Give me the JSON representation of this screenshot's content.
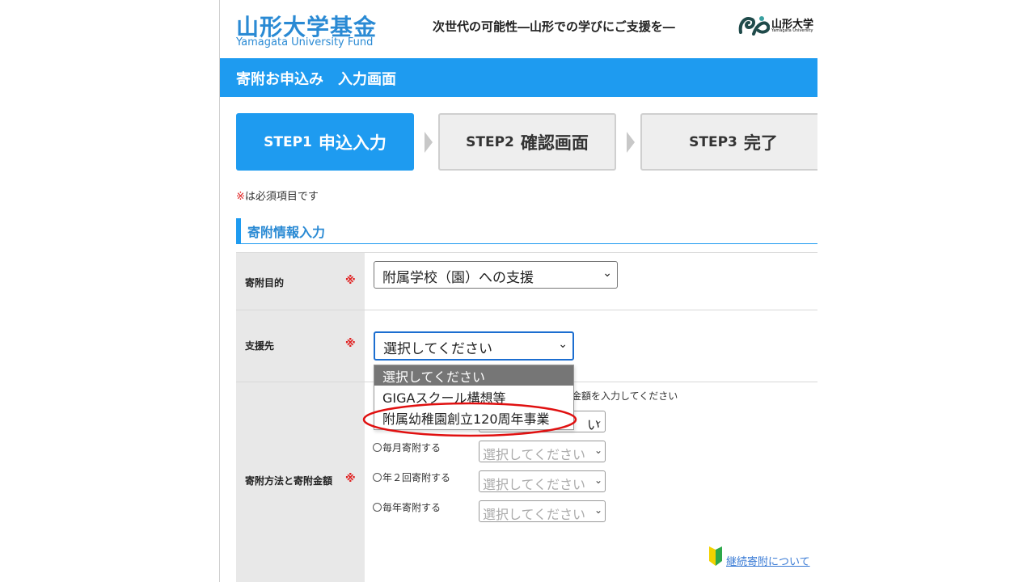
{
  "header": {
    "logo_main": "山形大学基金",
    "logo_sub": "Yamagata University Fund",
    "tagline": "次世代の可能性―山形での学びにご支援を―",
    "university_name": "山形大学",
    "university_name_en": "Yamagata University"
  },
  "page_title": "寄附お申込み　入力画面",
  "steps": [
    {
      "label": "STEP1",
      "name": "申込入力",
      "state": "active"
    },
    {
      "label": "STEP2",
      "name": "確認画面",
      "state": "inactive"
    },
    {
      "label": "STEP3",
      "name": "完了",
      "state": "inactive"
    }
  ],
  "required_note": {
    "mark": "※",
    "text": "は必須項目です"
  },
  "section_title": "寄附情報入力",
  "form": {
    "purpose": {
      "label": "寄附目的",
      "required_mark": "※",
      "value": "附属学校（園）への支援"
    },
    "target": {
      "label": "支援先",
      "required_mark": "※",
      "value": "選択してください",
      "options": [
        "選択してください",
        "GIGAスクール構想等",
        "附属幼稚園創立120周年事業"
      ],
      "highlighted_option": "附属幼稚園創立120周年事業"
    },
    "method": {
      "label": "寄附方法と寄附金額",
      "required_mark": "※",
      "hint": "金額を入力してください",
      "first_select_visible_text": "い",
      "rows": [
        {
          "label": "毎月寄附する",
          "value": "選択してください"
        },
        {
          "label": "年２回寄附する",
          "value": "選択してください"
        },
        {
          "label": "毎年寄附する",
          "value": "選択してください"
        }
      ]
    }
  },
  "link_continuous": "継続寄附について",
  "colors": {
    "accent": "#1e9bf0",
    "logo": "#2a8ad4",
    "required": "#e02020",
    "annotation": "#e01010"
  }
}
